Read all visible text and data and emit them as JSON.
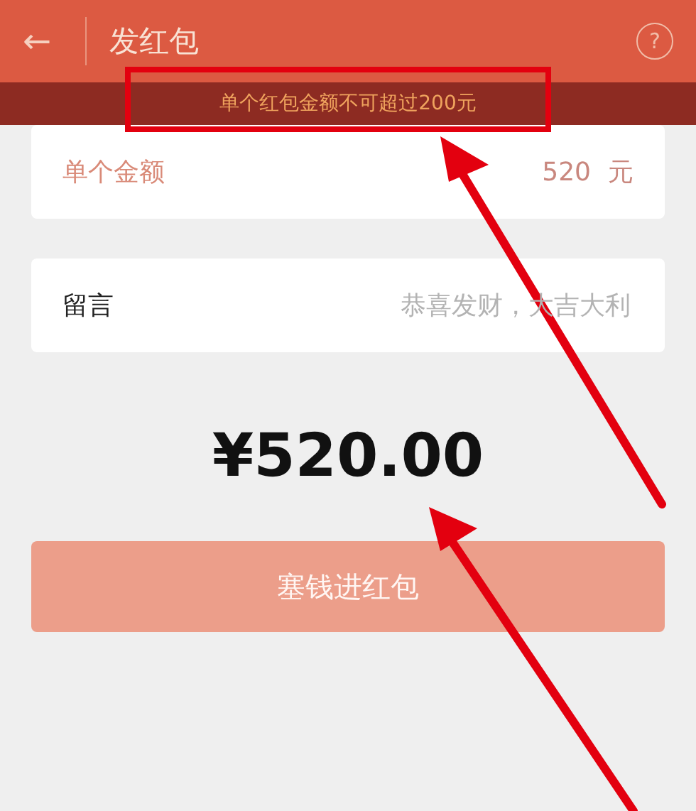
{
  "header": {
    "back_icon": "←",
    "title": "发红包",
    "help_icon": "?"
  },
  "warning": "单个红包金额不可超过200元",
  "amount_field": {
    "label": "单个金额",
    "value": "520",
    "unit": "元",
    "error": true
  },
  "message_field": {
    "label": "留言",
    "placeholder": "恭喜发财，大吉大利"
  },
  "total": "¥520.00",
  "submit_button": {
    "label": "塞钱进红包",
    "disabled": true
  }
}
